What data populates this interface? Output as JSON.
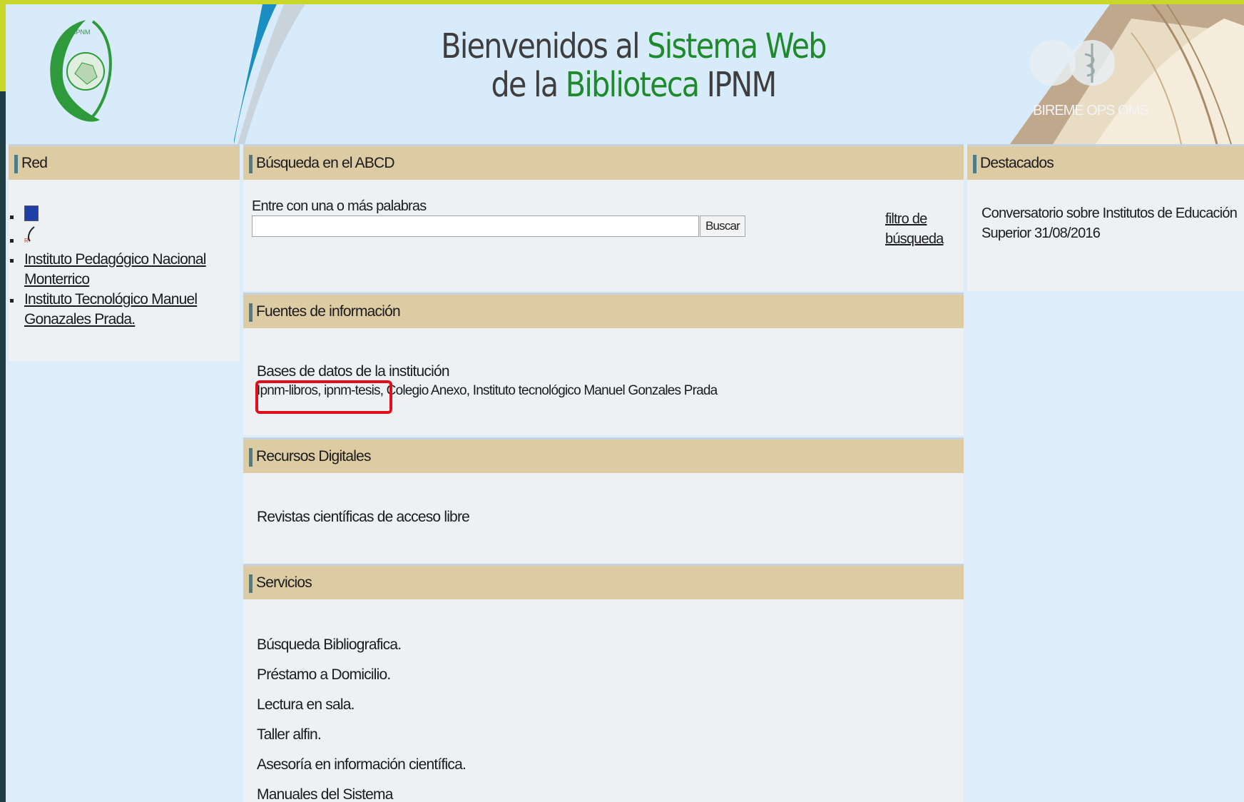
{
  "header": {
    "title_line1_a": "Bienvenidos al ",
    "title_line1_b": "Sistema Web",
    "title_line2_a": "de la ",
    "title_line2_b": "Biblioteca",
    "title_line2_c": " IPNM",
    "partner_text": "BIREME OPS OMS"
  },
  "left": {
    "title": "Red",
    "links": [
      {
        "label": "Instituto Pedagógico Nacional",
        "label2": "Monterrico"
      },
      {
        "label": "Instituto Tecnológico Manuel",
        "label2": "Gonazales Prada."
      }
    ]
  },
  "search": {
    "title": "Búsqueda en el ABCD",
    "prompt": "Entre con una o más palabras",
    "input_value": "",
    "button_label": "Buscar",
    "filter_line1": "filtro de",
    "filter_line2": "búsqueda"
  },
  "sources": {
    "title": "Fuentes de información",
    "subtitle": "Bases de datos de la institución",
    "list_text": "Ipnm-libros, ipnm-tesis, Colegio Anexo, Instituto tecnológico Manuel Gonzales Prada"
  },
  "digital": {
    "title": "Recursos Digitales",
    "item": "Revistas científicas de acceso libre"
  },
  "services": {
    "title": "Servicios",
    "items": [
      "Búsqueda Bibliografica.",
      "Préstamo a Domicilio.",
      "Lectura en sala.",
      "Taller alfin.",
      "Asesoría en información científica.",
      "Manuales del Sistema"
    ]
  },
  "featured": {
    "title": "Destacados",
    "line1": "Conversatorio sobre Institutos de Educación",
    "line2": "Superior 31/08/2016"
  },
  "colors": {
    "accent_green": "#1f8a2c",
    "panel_header": "#dccba3",
    "highlight_red": "#e20f1a"
  }
}
